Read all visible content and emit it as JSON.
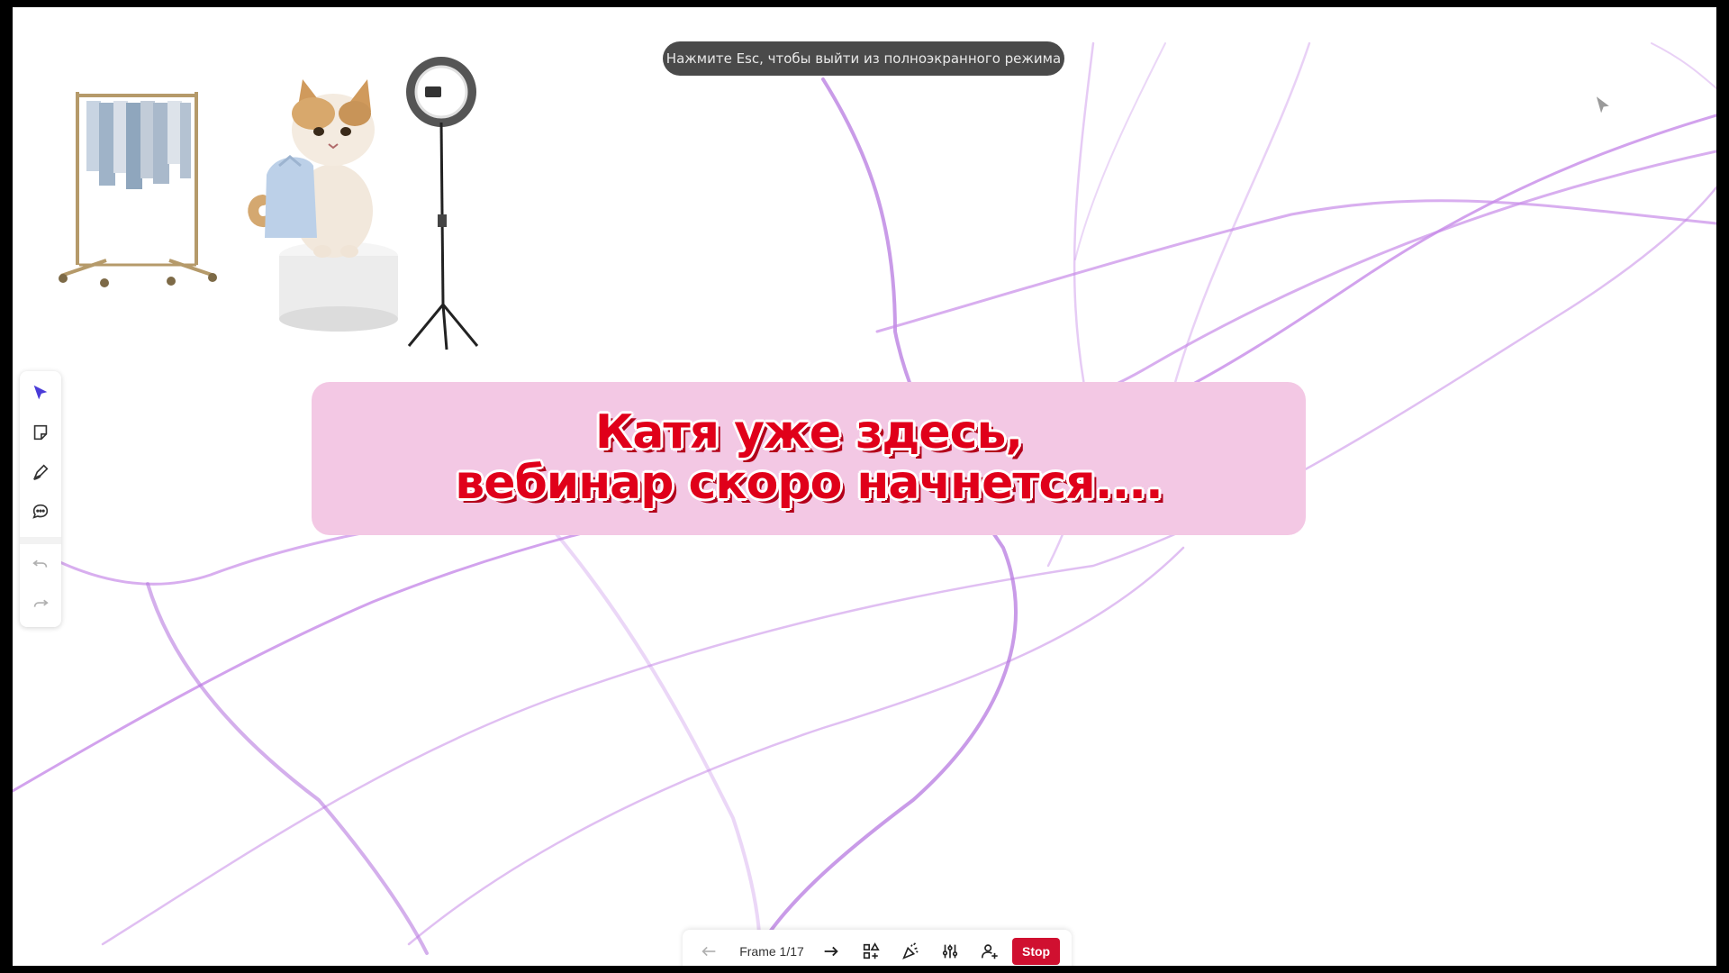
{
  "fullscreen_toast": {
    "text": "Нажмите Esc, чтобы выйти из полноэкранного режима"
  },
  "banner": {
    "line1": "Катя уже здесь,",
    "line2": "вебинар скоро начнется...."
  },
  "left_toolbar": {
    "items": [
      {
        "icon": "cursor-arrow-icon",
        "active": true
      },
      {
        "icon": "sticky-note-icon",
        "active": false
      },
      {
        "icon": "pen-icon",
        "active": false
      },
      {
        "icon": "comment-icon",
        "active": false
      },
      {
        "icon": "undo-icon",
        "active": false
      },
      {
        "icon": "redo-icon",
        "active": false
      }
    ]
  },
  "bottom_bar": {
    "prev_icon": "arrow-left-icon",
    "frame_label": "Frame 1/17",
    "next_icon": "arrow-right-icon",
    "tools": [
      "add-shapes-icon",
      "reactions-icon",
      "settings-sliders-icon",
      "add-user-icon"
    ],
    "stop_label": "Stop"
  },
  "colors": {
    "banner_bg": "#f3c8e4",
    "banner_text": "#e0001a",
    "accent": "#4a3bd8",
    "stop": "#d01030",
    "curves": "#c78be8"
  }
}
